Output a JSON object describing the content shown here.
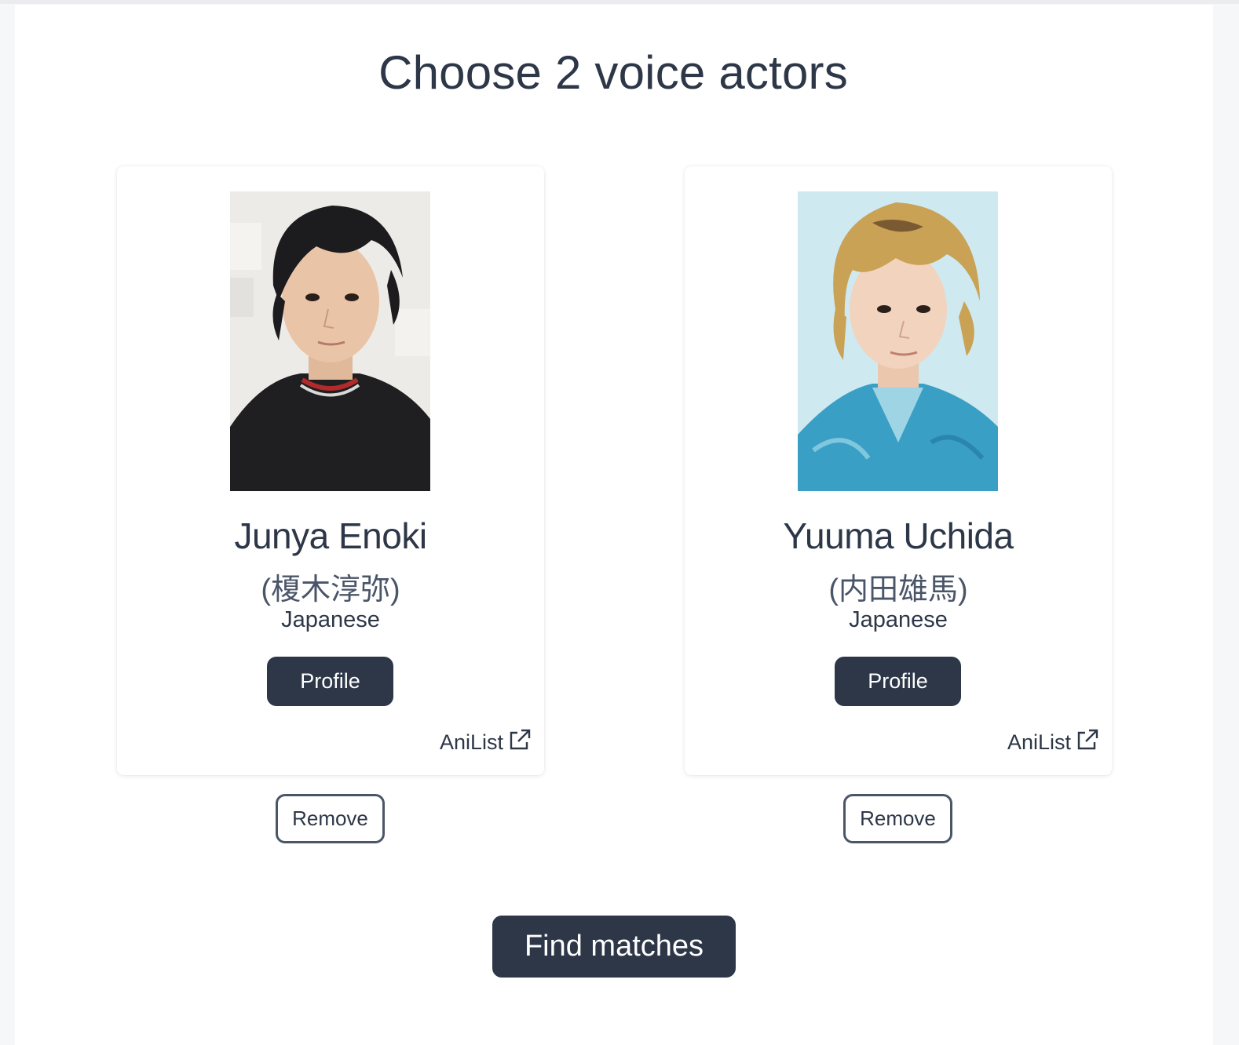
{
  "page": {
    "title": "Choose 2 voice actors"
  },
  "actors": [
    {
      "name": "Junya Enoki",
      "native_name": "(榎木淳弥)",
      "language": "Japanese",
      "profile_label": "Profile",
      "anilist_label": "AniList",
      "remove_label": "Remove",
      "photo_background": "#ecebe8",
      "hair_color": "#1c1c1e",
      "shirt_color": "#1f1f21"
    },
    {
      "name": "Yuuma Uchida",
      "native_name": "(内田雄馬)",
      "language": "Japanese",
      "profile_label": "Profile",
      "anilist_label": "AniList",
      "remove_label": "Remove",
      "photo_background": "#cfe9f1",
      "hair_color": "#c9a255",
      "shirt_color": "#3a9fc4"
    }
  ],
  "actions": {
    "find_matches_label": "Find matches"
  },
  "colors": {
    "primary": "#2d3748",
    "text": "#2d3748",
    "muted_text": "#4a5568",
    "page_background": "#f6f7f9",
    "card_background": "#ffffff"
  },
  "icons": {
    "anilist_link": "external-link-icon"
  }
}
